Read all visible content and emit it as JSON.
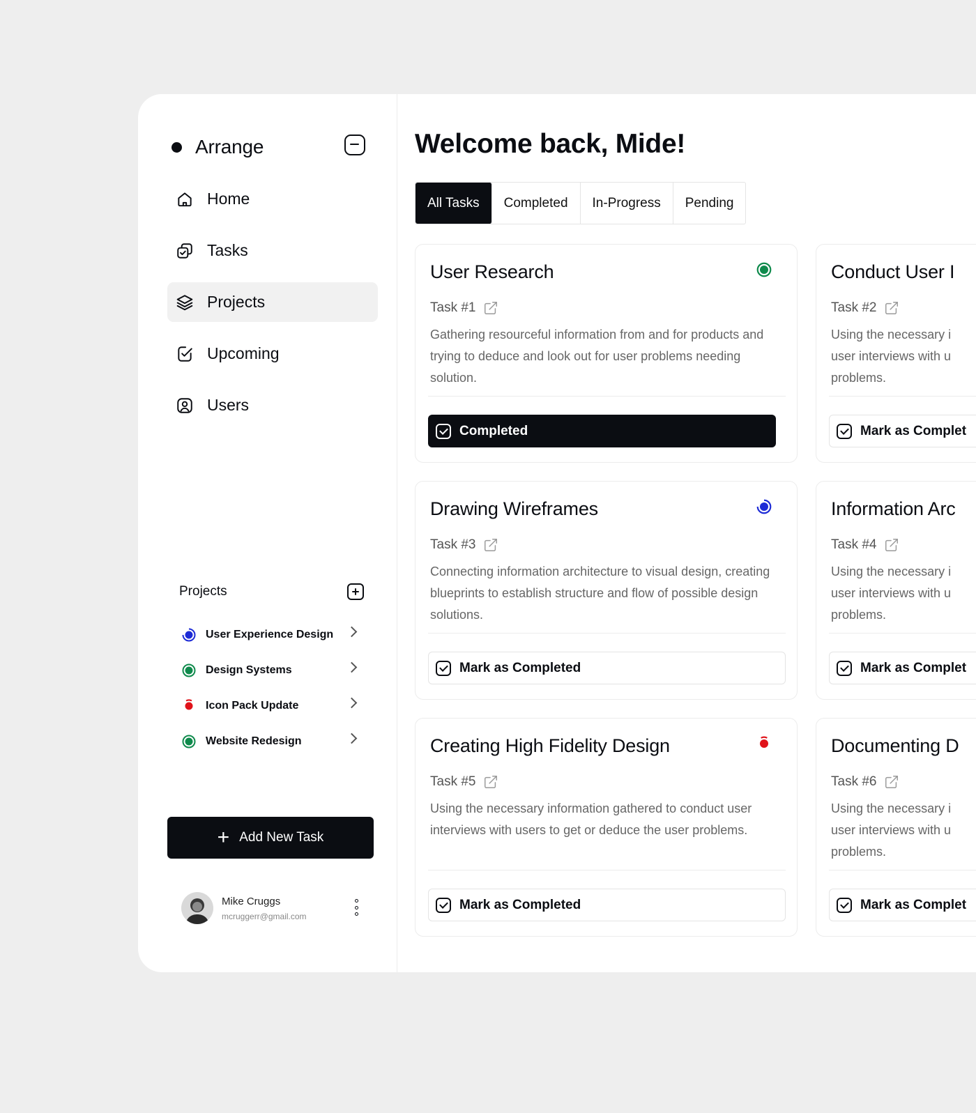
{
  "sidebar": {
    "brand": "Arrange",
    "nav": [
      {
        "label": "Home",
        "icon": "home-icon"
      },
      {
        "label": "Tasks",
        "icon": "tasks-icon"
      },
      {
        "label": "Projects",
        "icon": "layers-icon",
        "active": true
      },
      {
        "label": "Upcoming",
        "icon": "calendar-check-icon"
      },
      {
        "label": "Users",
        "icon": "user-icon"
      }
    ],
    "projects_title": "Projects",
    "projects": [
      {
        "label": "User Experience Design",
        "status": "in-progress",
        "color": "#1d2bd6"
      },
      {
        "label": "Design Systems",
        "status": "completed",
        "color": "#0f8a4c"
      },
      {
        "label": "Icon Pack Update",
        "status": "pending",
        "color": "#e0131a"
      },
      {
        "label": "Website Redesign",
        "status": "completed",
        "color": "#0f8a4c"
      }
    ],
    "add_task_label": "Add New Task",
    "profile": {
      "name": "Mike Cruggs",
      "email": "mcruggerr@gmail.com"
    }
  },
  "main": {
    "welcome": "Welcome back, Mide!",
    "tabs": [
      {
        "label": "All Tasks",
        "active": true
      },
      {
        "label": "Completed"
      },
      {
        "label": "In-Progress"
      },
      {
        "label": "Pending"
      }
    ],
    "cards": [
      {
        "title": "User Research",
        "task": "Task #1",
        "desc": "Gathering resourceful information from and for products and trying to deduce and look out for user problems needing solution.",
        "button": "Completed",
        "done": true,
        "status": "completed"
      },
      {
        "title": "Conduct User I",
        "task": "Task #2",
        "desc": "Using the necessary i user interviews with u problems.",
        "button": "Mark as Complet",
        "done": false,
        "status": "none"
      },
      {
        "title": "Drawing Wireframes",
        "task": "Task #3",
        "desc": "Connecting information architecture to visual design, creating blueprints to establish structure and flow of possible design solutions.",
        "button": "Mark as Completed",
        "done": false,
        "status": "in-progress"
      },
      {
        "title": "Information Arc",
        "task": "Task #4",
        "desc": "Using the necessary i user interviews with u problems.",
        "button": "Mark as Complet",
        "done": false,
        "status": "none"
      },
      {
        "title": "Creating High Fidelity Design",
        "task": "Task #5",
        "desc": "Using the necessary information gathered to conduct user interviews with users to get or deduce the user problems.",
        "button": "Mark as Completed",
        "done": false,
        "status": "pending"
      },
      {
        "title": "Documenting D",
        "task": "Task #6",
        "desc": "Using the necessary i user interviews with u problems.",
        "button": "Mark as Complet",
        "done": false,
        "status": "none"
      }
    ]
  },
  "colors": {
    "primary": "#0b0d12",
    "completed": "#0f8a4c",
    "in_progress": "#1d2bd6",
    "pending": "#e0131a"
  }
}
